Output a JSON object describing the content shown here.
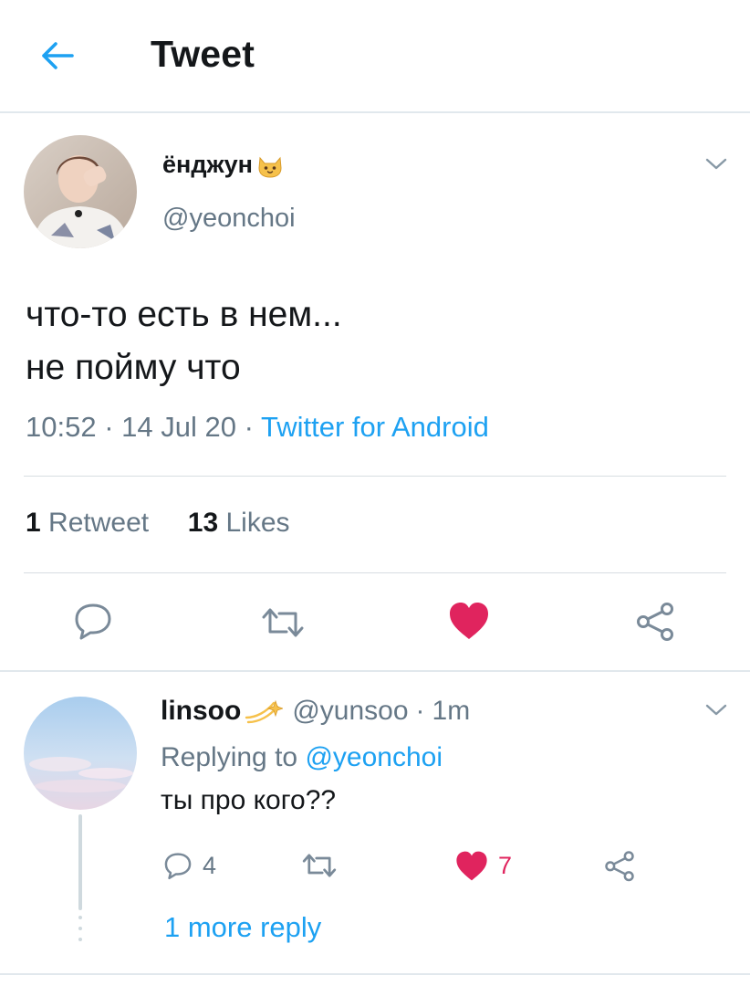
{
  "header": {
    "title": "Tweet",
    "back_icon": "arrow-left-icon"
  },
  "tweet": {
    "author_name": "ёнджун",
    "author_emoji": "cat-face-emoji",
    "author_handle": "@yeonchoi",
    "text": "что-то есть в нем...\nне пойму что",
    "time": "10:52",
    "date": "14 Jul 20",
    "source": "Twitter for Android",
    "retweet_count": "1",
    "retweet_label": "Retweet",
    "like_count": "13",
    "like_label": "Likes",
    "liked": true
  },
  "reply": {
    "author_name": "linsoo",
    "author_emoji": "shooting-star-emoji",
    "author_handle": "@yunsoo",
    "time": "1m",
    "replying_prefix": "Replying to",
    "replying_to": "@yeonchoi",
    "text": "ты про кого??",
    "reply_count": "4",
    "like_count": "7",
    "more_replies": "1 more reply"
  },
  "colors": {
    "accent": "#1da1f2",
    "like": "#e0245e",
    "muted": "#657786",
    "icon": "#7a8a99"
  }
}
